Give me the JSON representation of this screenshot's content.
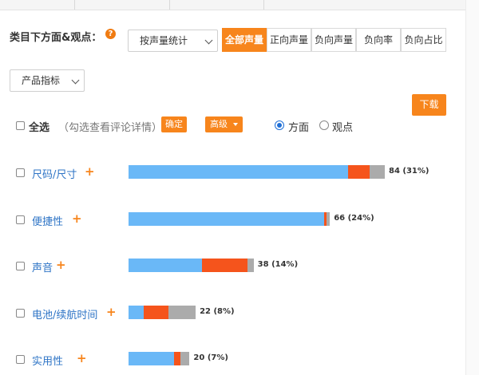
{
  "heading": "类目下方面&观点：",
  "help_icon_glyph": "?",
  "stat_select": {
    "value": "按声量统计"
  },
  "metric_select": {
    "value": "产品指标"
  },
  "segments": [
    {
      "label": "全部声量",
      "active": true
    },
    {
      "label": "正向声量",
      "active": false
    },
    {
      "label": "负向声量",
      "active": false
    },
    {
      "label": "负向率",
      "active": false
    },
    {
      "label": "负向占比",
      "active": false
    }
  ],
  "download_label": "下载",
  "select_all_label": "全选",
  "hint": "（勾选查看评论详情）",
  "confirm_label": "确定",
  "advanced_label": "高级",
  "radios": [
    {
      "label": "方面",
      "checked": true
    },
    {
      "label": "观点",
      "checked": false
    }
  ],
  "plus_glyph": "+",
  "colors": {
    "accent": "#f7851c",
    "positive": "#6ab8f7",
    "negative": "#f5541c",
    "neutral": "#ababab",
    "link": "#2e74c6"
  },
  "chart_data": {
    "type": "bar",
    "orientation": "horizontal",
    "stacked": true,
    "categories": [
      "尺码/尺寸",
      "便捷性",
      "声音",
      "电池/续航时间",
      "实用性"
    ],
    "series": [
      {
        "values": [
          72,
          64,
          24,
          5,
          15
        ]
      },
      {
        "values": [
          7,
          1,
          15,
          8,
          2
        ]
      },
      {
        "values": [
          5,
          1,
          2,
          9,
          3
        ]
      }
    ],
    "value_labels": [
      "84 (31%)",
      "66 (24%)",
      "38 (14%)",
      "22 (8%)",
      "20 (7%)"
    ],
    "xlim": [
      0,
      84
    ]
  }
}
